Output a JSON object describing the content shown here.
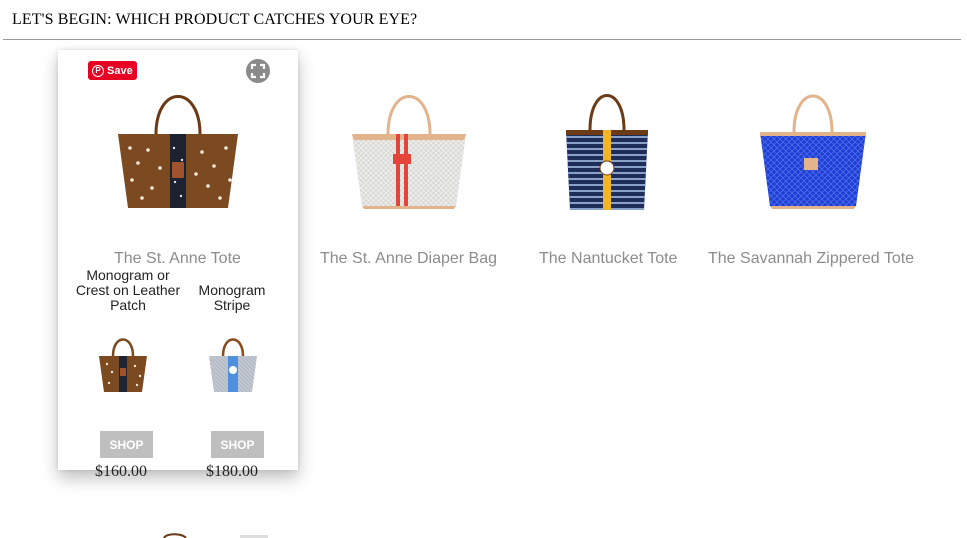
{
  "heading": "LET'S BEGIN: WHICH PRODUCT CATCHES YOUR EYE?",
  "card": {
    "save_label": "Save",
    "variants": [
      {
        "label": "Monogram or Crest on Leather Patch",
        "price": "$160.00",
        "shop": "SHOP"
      },
      {
        "label": "Monogram Stripe",
        "price": "$180.00",
        "shop": "SHOP"
      }
    ]
  },
  "products": [
    {
      "title": "The St. Anne Tote"
    },
    {
      "title": "The St. Anne Diaper Bag"
    },
    {
      "title": "The Nantucket Tote"
    },
    {
      "title": "The Savannah Zippered Tote"
    }
  ],
  "colors": {
    "pinterest": "#e60023",
    "title_gray": "#8c8c8c",
    "shop_gray": "#bfbfbf"
  }
}
